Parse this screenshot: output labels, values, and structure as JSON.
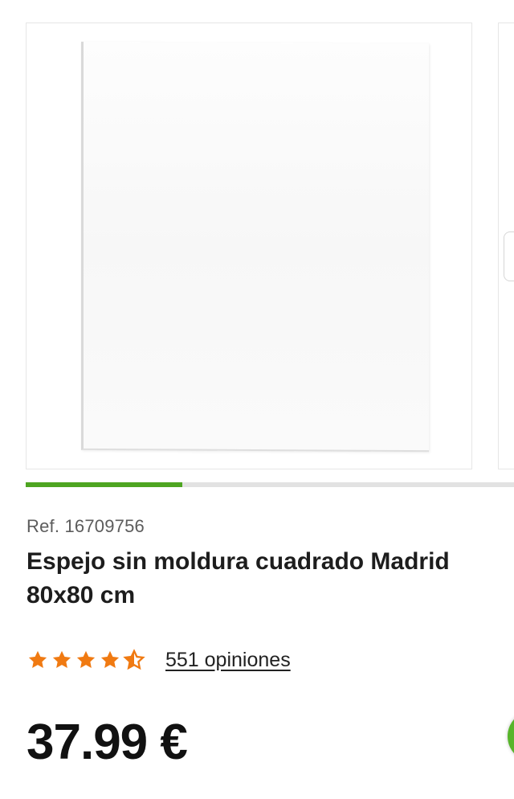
{
  "carousel": {
    "current_slide": 1,
    "progress_fraction": 0.32,
    "accent_color": "#4ea521",
    "image_label": "mirror-image"
  },
  "product": {
    "ref": "Ref. 16709756",
    "title_line1": "Espejo sin moldura cuadrado Madrid",
    "title_line2": "80x80 cm",
    "rating": 4.5,
    "rating_max": 5,
    "star_color": "#f07a12",
    "reviews_label": "551 opiniones",
    "price": "37.99 €"
  },
  "icons": {
    "star": "star-icon",
    "half_star": "half-star-icon",
    "chat": "chat-icon"
  }
}
